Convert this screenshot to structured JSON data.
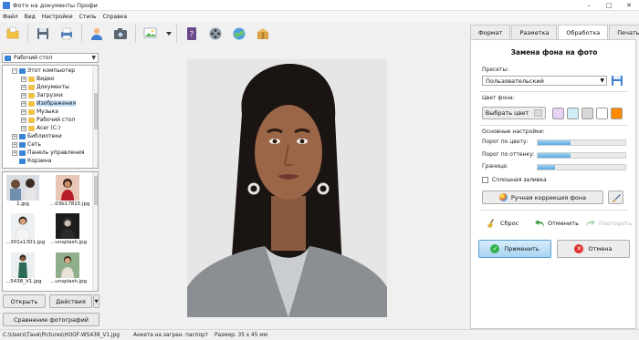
{
  "window": {
    "title": "Фото на документы Профи",
    "min": "–",
    "max": "□",
    "close": "✕"
  },
  "menu": [
    "Файл",
    "Вид",
    "Настройки",
    "Стиль",
    "Справка"
  ],
  "toolbar_icons": [
    "open-folder-icon",
    "save-disk-icon",
    "print-icon",
    "person-icon",
    "camera-icon",
    "image-settings-icon",
    "help-book-icon",
    "film-reel-icon",
    "web-globe-icon",
    "package-box-icon"
  ],
  "left": {
    "folder_combo": "Рабочий стол",
    "tree": [
      {
        "label": "Этот компьютер",
        "level": 1,
        "exp": "−"
      },
      {
        "label": "Видео",
        "level": 2,
        "exp": "+"
      },
      {
        "label": "Документы",
        "level": 2,
        "exp": "+"
      },
      {
        "label": "Загрузки",
        "level": 2,
        "exp": "+"
      },
      {
        "label": "Изображения",
        "level": 2,
        "exp": "+",
        "selected": true
      },
      {
        "label": "Музыка",
        "level": 2,
        "exp": "+"
      },
      {
        "label": "Рабочий стол",
        "level": 2,
        "exp": "+"
      },
      {
        "label": "Acer (C:)",
        "level": 2,
        "exp": "+"
      },
      {
        "label": "Библиотеки",
        "level": 1,
        "exp": "+"
      },
      {
        "label": "Сеть",
        "level": 1,
        "exp": "+"
      },
      {
        "label": "Панель управления",
        "level": 1,
        "exp": "+"
      },
      {
        "label": "Корзина",
        "level": 1,
        "exp": ""
      }
    ],
    "thumbnails": [
      {
        "caption": "1.jpg"
      },
      {
        "caption": "...03b17815.jpg"
      },
      {
        "caption": "...301x1301.jpg"
      },
      {
        "caption": "...unsplash.jpg"
      },
      {
        "caption": "...5438_V1.jpg"
      },
      {
        "caption": "...unsplash.jpg"
      }
    ],
    "open_button": "Открыть",
    "actions_button": "Действия",
    "compare_button": "Сравнение фотографий"
  },
  "tabs": [
    "Формат",
    "Разметка",
    "Обработка",
    "Печать"
  ],
  "active_tab": "Обработка",
  "panel": {
    "title": "Замена фона на фото",
    "presets_label": "Пресеты:",
    "preset_value": "Пользовательский",
    "bg_color_label": "Цвет фона:",
    "choose_color_button": "Выбрать цвет",
    "swatches": [
      "#e8d2f2",
      "#cfeef8",
      "#d7d7d7",
      "#ffffff",
      "#ff8a00"
    ],
    "advanced_label": "Основные настройки:",
    "sliders": [
      {
        "label": "Порог по цвету:",
        "value": 0.38
      },
      {
        "label": "Порог по оттенку:",
        "value": 0.37
      },
      {
        "label": "Граница:",
        "value": 0.2
      }
    ],
    "solid_fill_label": "Сплошная заливка",
    "manual_button": "Ручная коррекция фона",
    "reset_button": "Сброс",
    "undo_button": "Отменить",
    "redo_button": "Повторить",
    "apply_button": "Применить",
    "cancel_button": "Отмена"
  },
  "status": {
    "path": "C:\\Users\\Таня\\Pictures\\HOOF-WS438_V1.jpg",
    "template": "Анкета на загран. паспорт",
    "size": "Размер: 35 x 45 мм"
  }
}
